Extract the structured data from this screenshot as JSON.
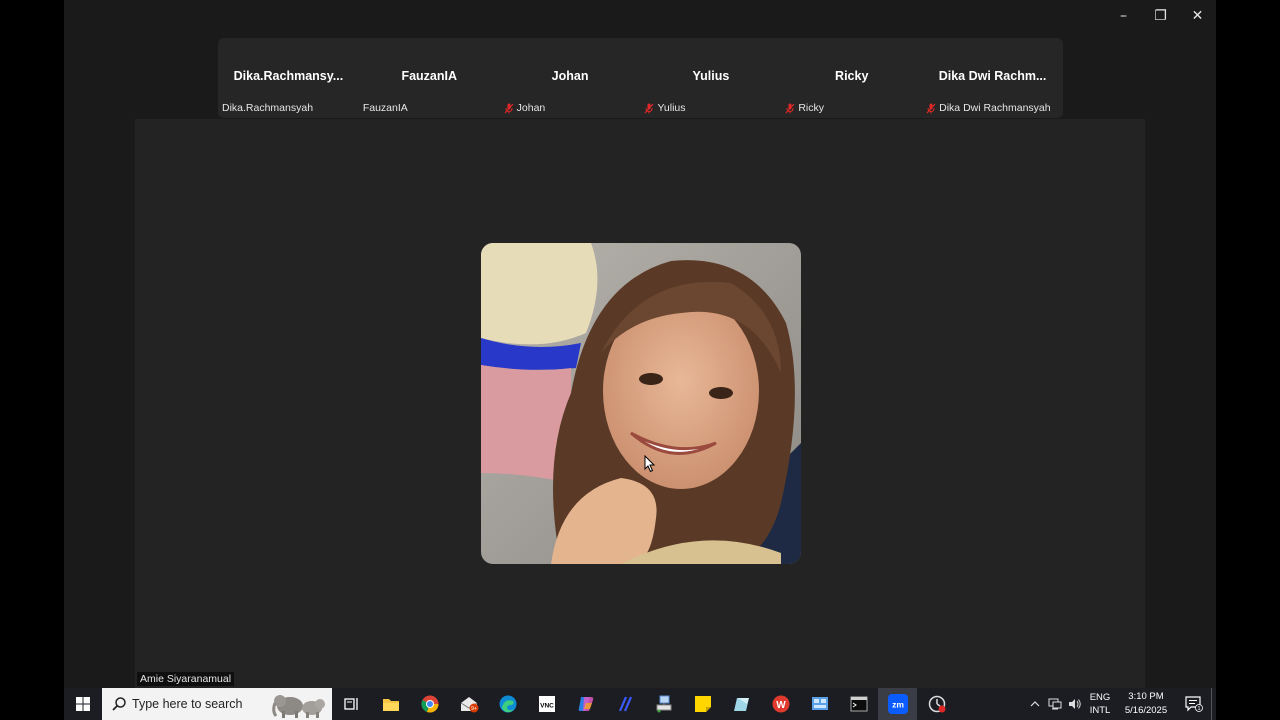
{
  "window": {
    "controls": {
      "minimize": "–",
      "restore": "❐",
      "close": "✕"
    }
  },
  "participants": [
    {
      "display_name": "Dika.Rachmansy...",
      "label": "Dika.Rachmansyah",
      "muted": false
    },
    {
      "display_name": "FauzanIA",
      "label": "FauzanIA",
      "muted": false
    },
    {
      "display_name": "Johan",
      "label": "Johan",
      "muted": true
    },
    {
      "display_name": "Yulius",
      "label": "Yulius",
      "muted": true
    },
    {
      "display_name": "Ricky",
      "label": "Ricky",
      "muted": true
    },
    {
      "display_name": "Dika  Dwi  Rachm...",
      "label": "Dika Dwi Rachmansyah",
      "muted": true
    }
  ],
  "active_speaker": {
    "name": "Amie Siyaranamual"
  },
  "taskbar": {
    "search_placeholder": "Type here to search",
    "apps": [
      "task-view",
      "file-explorer",
      "chrome",
      "mail",
      "edge",
      "vnc-viewer",
      "copilot",
      "visual-studio",
      "network-app",
      "sticky-notes",
      "notepad",
      "wps-office",
      "control-panel",
      "terminal",
      "zoom",
      "clock-app"
    ],
    "active_app": "zoom",
    "mail_badge": "9+",
    "language_line1": "ENG",
    "language_line2": "INTL",
    "time": "3:10 PM",
    "date": "5/16/2025",
    "notification_count": "1"
  },
  "colors": {
    "window_bg": "#1a1a1a",
    "strip_bg": "#262626",
    "stage_bg": "#232323",
    "mute_red": "#e02828",
    "taskbar_bg": "#1b1d23",
    "zoom_blue": "#0b5cff"
  }
}
